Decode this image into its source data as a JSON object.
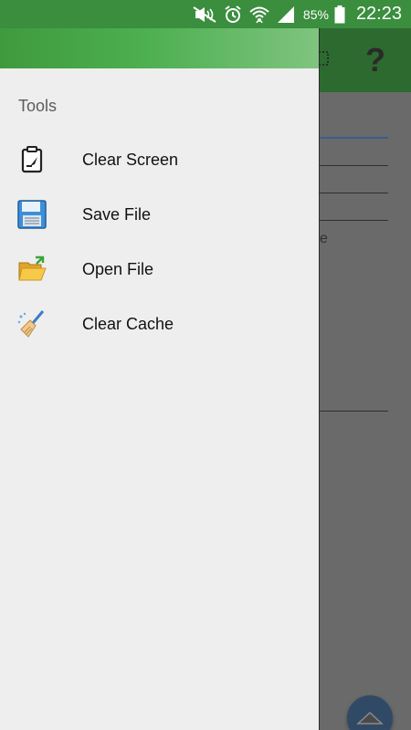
{
  "status_bar": {
    "battery_percent": "85%",
    "time": "22:23",
    "icons": [
      "mute-icon",
      "alarm-icon",
      "wifi-icon",
      "signal-icon",
      "battery-icon"
    ]
  },
  "drawer": {
    "section_title": "Tools",
    "items": [
      {
        "label": "Clear Screen",
        "icon": "clipboard-icon"
      },
      {
        "label": "Save File",
        "icon": "floppy-disk-icon"
      },
      {
        "label": "Open File",
        "icon": "open-folder-icon"
      },
      {
        "label": "Clear Cache",
        "icon": "broom-icon"
      }
    ]
  },
  "background_app": {
    "toolbar_help_glyph": "?",
    "partial_text": "e"
  },
  "colors": {
    "status_bar": "#3a8e3e",
    "drawer_header_start": "#3f9a3e",
    "drawer_header_end": "#7fc47f",
    "drawer_bg": "#eeeeee",
    "fab": "#304a66"
  }
}
